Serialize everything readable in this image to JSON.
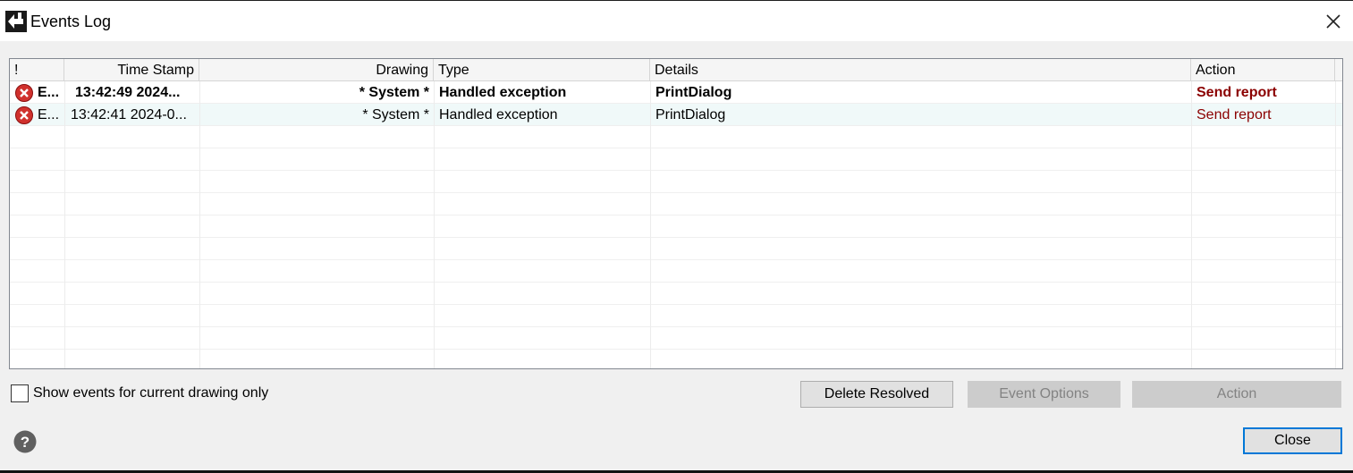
{
  "window": {
    "title": "Events Log"
  },
  "grid": {
    "columns": [
      "!",
      "Time Stamp",
      "Drawing",
      "Type",
      "Details",
      "Action"
    ],
    "rows": [
      {
        "severity": "E...",
        "time_stamp": "13:42:49 2024...",
        "drawing": "* System *",
        "type": "Handled exception",
        "details": "PrintDialog",
        "action": "Send report",
        "bold": true
      },
      {
        "severity": "E...",
        "time_stamp": "13:42:41 2024-0...",
        "drawing": "* System *",
        "type": "Handled exception",
        "details": "PrintDialog",
        "action": "Send report",
        "bold": false
      }
    ]
  },
  "filter": {
    "label": "Show events for current drawing only",
    "checked": false
  },
  "buttons": {
    "delete_resolved": "Delete Resolved",
    "event_options": "Event Options",
    "action": "Action",
    "close": "Close"
  },
  "colors": {
    "accent": "#0078d7",
    "action_link": "#8b0000",
    "error_icon": "#d0312d"
  },
  "icons": {
    "title": "app-icon",
    "close": "close-icon",
    "error": "error-icon",
    "help": "help-icon"
  }
}
